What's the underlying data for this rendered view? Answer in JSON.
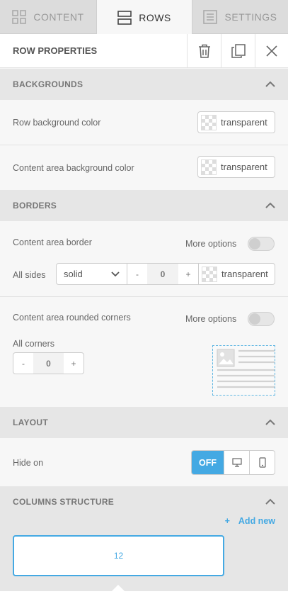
{
  "tabs": [
    {
      "label": "CONTENT",
      "icon": "grid-icon"
    },
    {
      "label": "ROWS",
      "icon": "rows-icon"
    },
    {
      "label": "SETTINGS",
      "icon": "settings-icon"
    }
  ],
  "header": {
    "title": "ROW PROPERTIES"
  },
  "backgrounds": {
    "title": "BACKGROUNDS",
    "row_bg_label": "Row background color",
    "row_bg_value": "transparent",
    "content_bg_label": "Content area background color",
    "content_bg_value": "transparent"
  },
  "borders": {
    "title": "BORDERS",
    "content_border_label": "Content area border",
    "more_options": "More options",
    "all_sides_label": "All sides",
    "style_value": "solid",
    "minus": "-",
    "width_value": "0",
    "plus": "+",
    "color_value": "transparent",
    "rounded_label": "Content area rounded corners",
    "rounded_more_options": "More options",
    "all_corners_label": "All corners",
    "corner_minus": "-",
    "corner_value": "0",
    "corner_plus": "+"
  },
  "layout": {
    "title": "LAYOUT",
    "hide_on_label": "Hide on",
    "off_label": "OFF"
  },
  "columns": {
    "title": "COLUMNS STRUCTURE",
    "add_plus": "+",
    "add_new": "Add new",
    "column_value": "12"
  },
  "colors": {
    "accent": "#44a9e3",
    "header_bg": "#e6e6e6",
    "panel_bg": "#f7f7f7"
  }
}
